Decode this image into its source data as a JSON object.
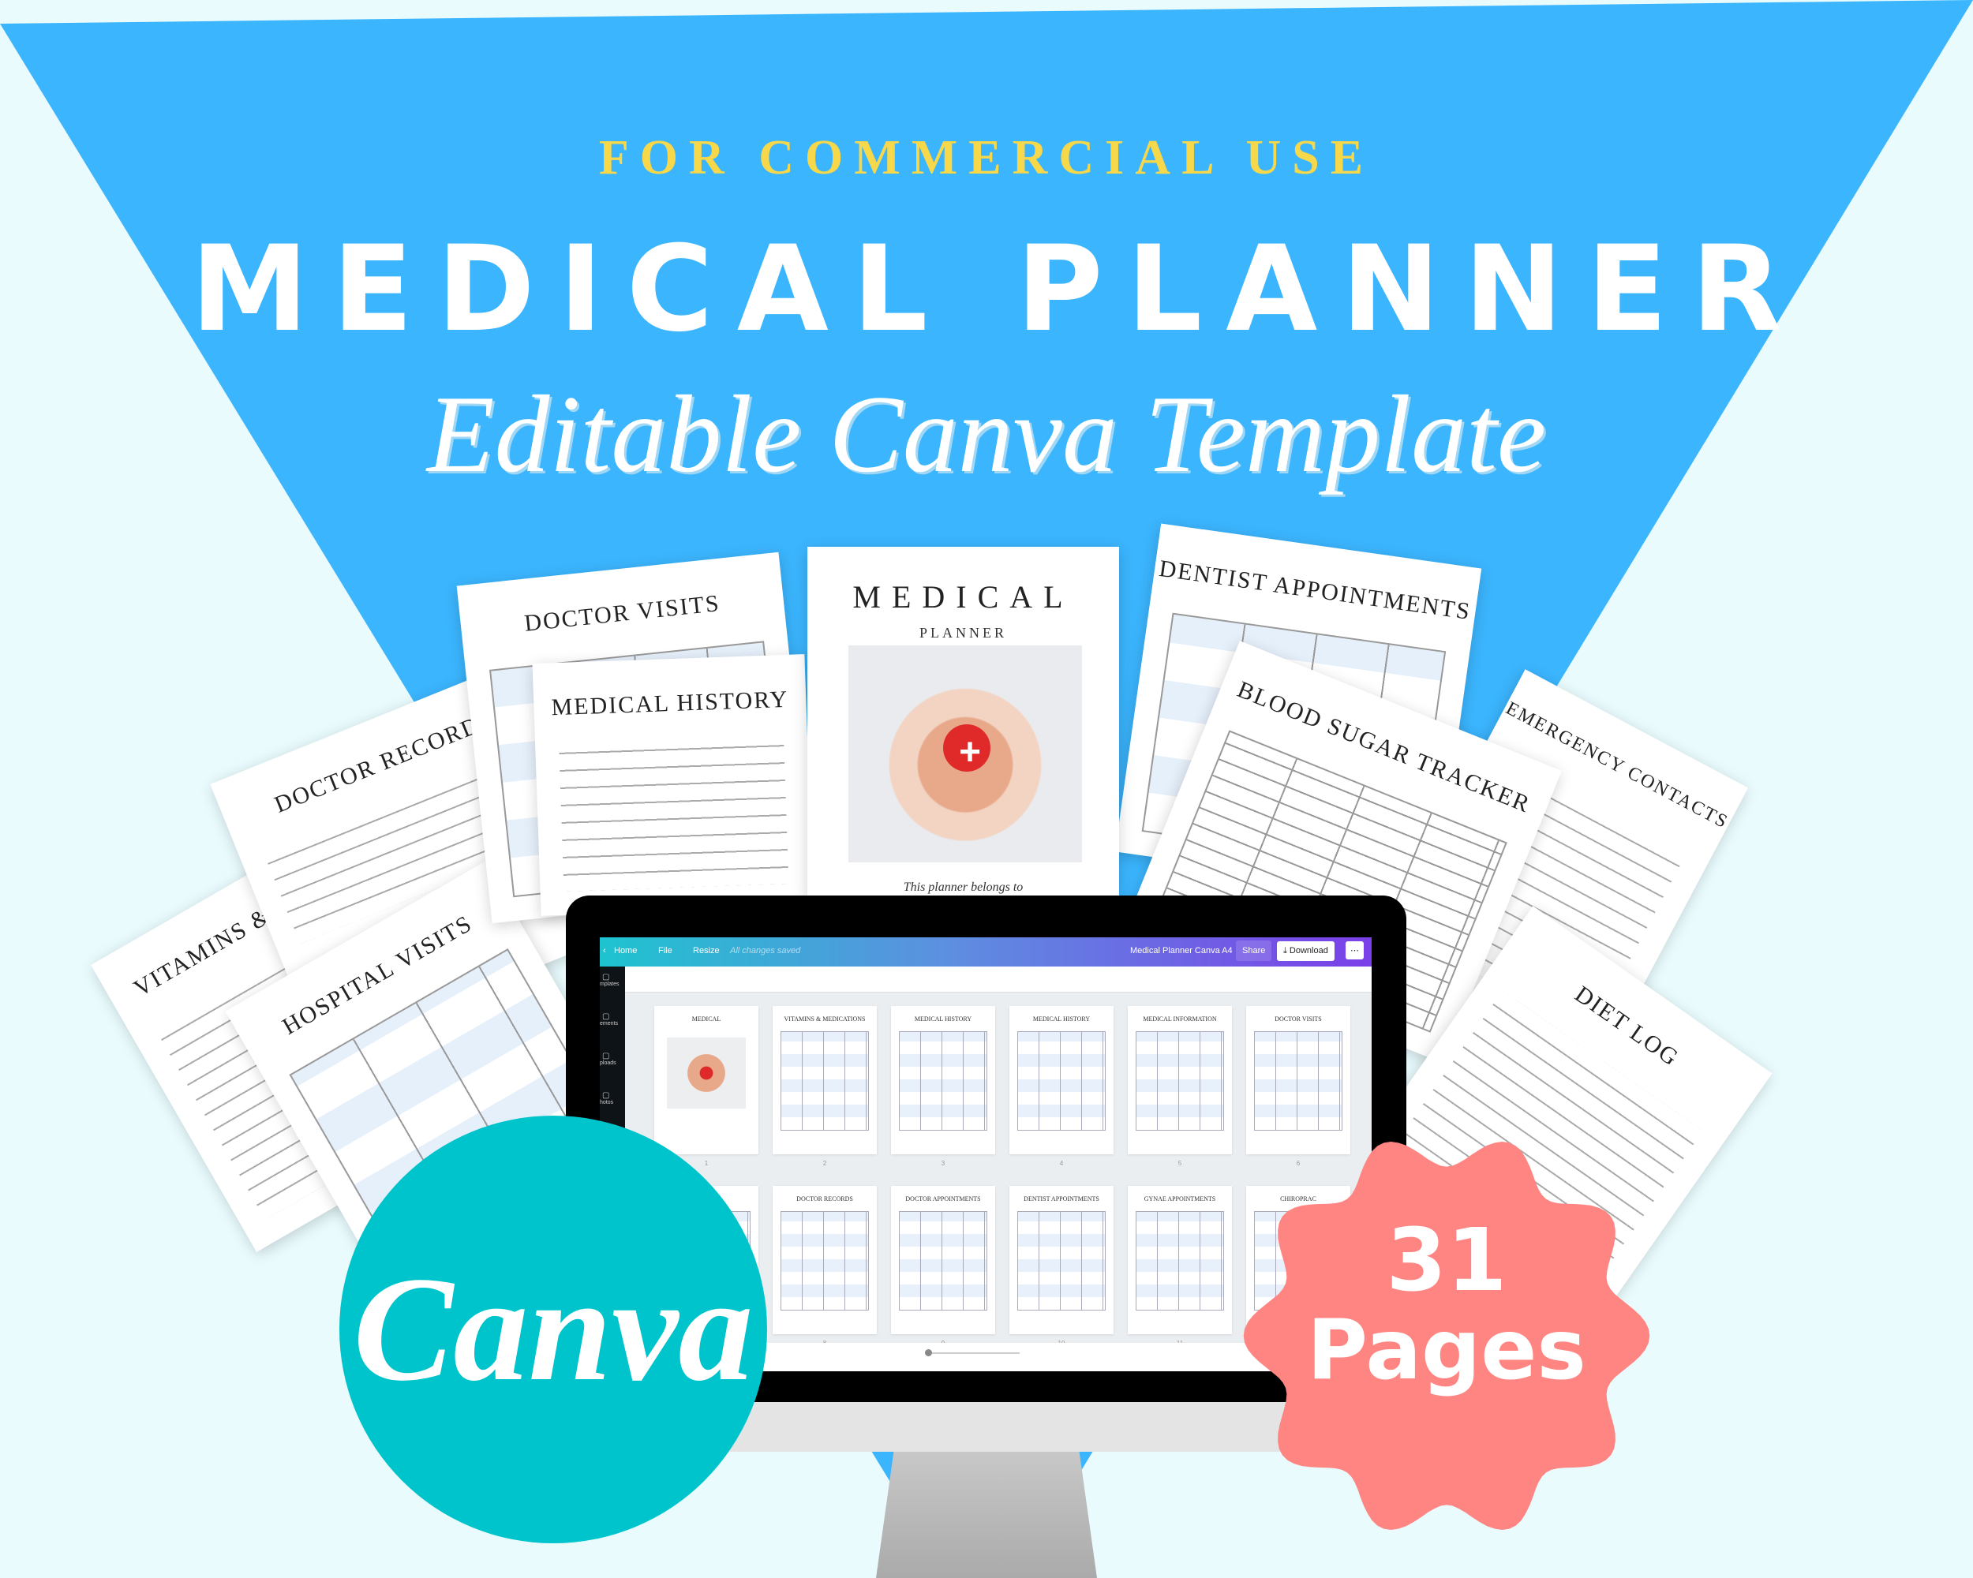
{
  "colors": {
    "blue": "#3bb5fe",
    "background": "#e9fbfd",
    "yellow": "#f6d84a",
    "canva_teal": "#00c4cc",
    "badge_coral": "#ff8583"
  },
  "header": {
    "kicker": "FOR COMMERCIAL USE",
    "title": "MEDICAL PLANNER",
    "subtitle": "Editable Canva Template"
  },
  "pages": {
    "doctor_visits": "DOCTOR VISITS",
    "medical_history": "MEDICAL HISTORY",
    "cover_title": "MEDICAL",
    "cover_sub": "PLANNER",
    "cover_belongs": "This planner belongs to",
    "dentist": "DENTIST APPOINTMENTS",
    "blood_sugar": "BLOOD SUGAR TRACKER",
    "emergency": "EMERGENCY CONTACTS",
    "diet": "DIET LOG",
    "doctor_records": "DOCTOR RECORDS",
    "vitamins": "VITAMINS & M",
    "hospital": "HOSPITAL VISITS"
  },
  "editor": {
    "home": "Home",
    "file": "File",
    "resize": "Resize",
    "saved": "All changes saved",
    "doc_title": "Medical Planner Canva A4",
    "share": "Share",
    "download": "Download",
    "more": "⋯",
    "sidebar": [
      "mplates",
      "ements",
      "ploads",
      "hotos"
    ],
    "thumbnails": [
      {
        "title": "MEDICAL",
        "num": "1"
      },
      {
        "title": "VITAMINS & MEDICATIONS",
        "num": "2"
      },
      {
        "title": "MEDICAL HISTORY",
        "num": "3"
      },
      {
        "title": "MEDICAL HISTORY",
        "num": "4"
      },
      {
        "title": "MEDICAL INFORMATION",
        "num": "5"
      },
      {
        "title": "DOCTOR VISITS",
        "num": "6"
      },
      {
        "title": "RDS",
        "num": ""
      },
      {
        "title": "DOCTOR RECORDS",
        "num": "8"
      },
      {
        "title": "DOCTOR APPOINTMENTS",
        "num": "9"
      },
      {
        "title": "DENTIST APPOINTMENTS",
        "num": "10"
      },
      {
        "title": "GYNAE APPOINTMENTS",
        "num": "11"
      },
      {
        "title": "CHIROPRAC",
        "num": ""
      }
    ]
  },
  "canva_logo": "Canva",
  "badge": {
    "count": "31",
    "label": "Pages"
  }
}
